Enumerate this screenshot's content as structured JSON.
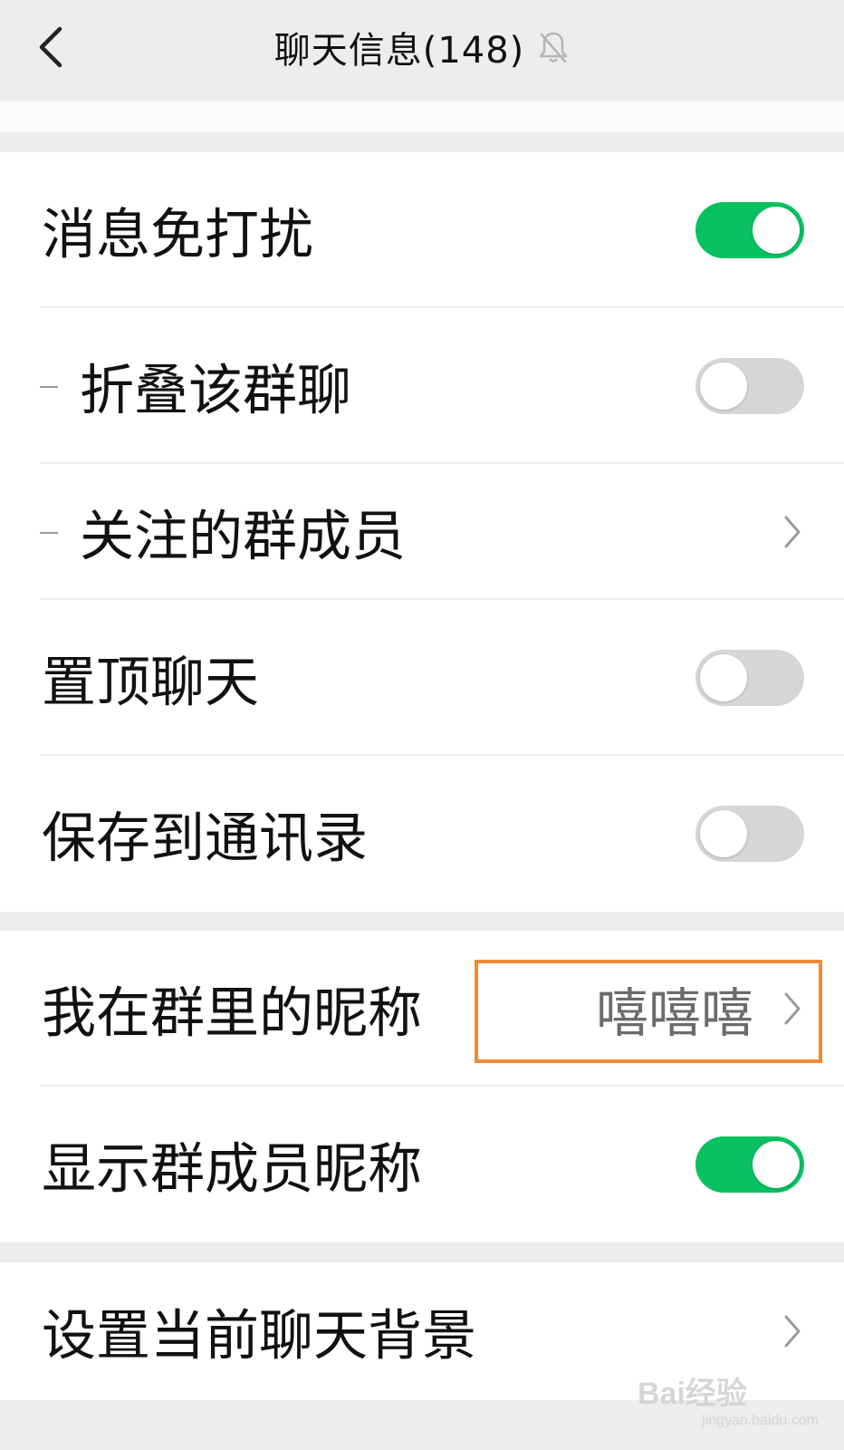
{
  "header": {
    "title": "聊天信息(148)",
    "back_icon": "chevron-left-icon",
    "mute_icon": "bell-off-icon"
  },
  "settings": {
    "do_not_disturb": {
      "label": "消息免打扰",
      "on": true
    },
    "fold_group": {
      "label": "折叠该群聊",
      "on": false
    },
    "followed_members": {
      "label": "关注的群成员"
    },
    "pin_chat": {
      "label": "置顶聊天",
      "on": false
    },
    "save_to_contacts": {
      "label": "保存到通讯录",
      "on": false
    },
    "my_nickname": {
      "label": "我在群里的昵称",
      "value": "嘻嘻嘻"
    },
    "show_nicknames": {
      "label": "显示群成员昵称",
      "on": true
    },
    "chat_background": {
      "label": "设置当前聊天背景"
    }
  },
  "watermark": {
    "brand": "Bai经验",
    "url": "jingyan.baidu.com"
  },
  "colors": {
    "toggle_on": "#07c160",
    "toggle_off": "#d6d6d6",
    "highlight": "#f08a33"
  }
}
